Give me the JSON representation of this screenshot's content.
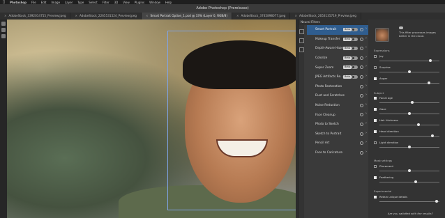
{
  "menubar": {
    "items": [
      "Photoshop",
      "File",
      "Edit",
      "Image",
      "Layer",
      "Type",
      "Select",
      "Filter",
      "3D",
      "View",
      "Plugins",
      "Window",
      "Help"
    ]
  },
  "window": {
    "title": "Adobe Photoshop (Prerelease)"
  },
  "tabs": [
    {
      "label": "AdobeStock_3392014755_Preview.jpeg",
      "active": false
    },
    {
      "label": "AdobeStock_2265531524_Preview.jpeg",
      "active": false
    },
    {
      "label": "Smart Portrait Option_1.psd @ 33% (Layer 0, RGB/8)",
      "active": true
    },
    {
      "label": "AdobeStock_3745898077.jpeg",
      "active": false
    },
    {
      "label": "AdobeStock_2653135719_Preview.jpeg",
      "active": false
    }
  ],
  "neural_filters": {
    "header": "Neural Filters",
    "badge_label": "Beta",
    "filters": [
      {
        "name": "Smart Portrait",
        "beta": true,
        "toggle": true,
        "active": true
      },
      {
        "name": "Makeup Transfer",
        "beta": true,
        "toggle": true,
        "active": false
      },
      {
        "name": "Depth-Aware Haze",
        "beta": true,
        "toggle": true,
        "active": false
      },
      {
        "name": "Colorize",
        "beta": true,
        "toggle": true,
        "active": false
      },
      {
        "name": "Super Zoom",
        "beta": true,
        "toggle": true,
        "active": false
      },
      {
        "name": "JPEG Artifacts Re...",
        "beta": true,
        "toggle": true,
        "active": false
      },
      {
        "name": "Photo Restoration",
        "beta": false,
        "toggle": false,
        "active": false
      },
      {
        "name": "Dust and Scratches",
        "beta": false,
        "toggle": false,
        "active": false
      },
      {
        "name": "Noise Reduction",
        "beta": false,
        "toggle": false,
        "active": false
      },
      {
        "name": "Face Cleanup",
        "beta": false,
        "toggle": false,
        "active": false
      },
      {
        "name": "Photo to Sketch",
        "beta": false,
        "toggle": false,
        "active": false
      },
      {
        "name": "Sketch to Portrait",
        "beta": false,
        "toggle": false,
        "active": false
      },
      {
        "name": "Pencil Art",
        "beta": false,
        "toggle": false,
        "active": false
      },
      {
        "name": "Face to Caricature",
        "beta": false,
        "toggle": false,
        "active": false
      }
    ]
  },
  "smart_portrait": {
    "description": "This filter processes images better in the cloud.",
    "sections": {
      "expressions": "Expressions",
      "subject": "Subject",
      "mask_settings": "Mask settings",
      "experimental": "Experimental"
    },
    "sliders": [
      {
        "label": "Joy",
        "value": "",
        "checked": false,
        "position": 0.85
      },
      {
        "label": "Surprise",
        "value": "",
        "checked": false,
        "position": 0.5
      },
      {
        "label": "Anger",
        "value": "",
        "checked": true,
        "position": 0.82
      },
      {
        "label": "Facial age",
        "value": "",
        "checked": true,
        "position": 0.55
      },
      {
        "label": "Gaze",
        "value": "",
        "checked": true,
        "position": 0.5
      },
      {
        "label": "Hair thickness",
        "value": "",
        "checked": true,
        "position": 0.65
      },
      {
        "label": "Head direction",
        "value": "",
        "checked": true,
        "position": 0.88
      },
      {
        "label": "Light direction",
        "value": "",
        "checked": false,
        "position": 0.5
      },
      {
        "label": "Placement",
        "value": "",
        "checked": false,
        "position": 0.5
      },
      {
        "label": "Feathering",
        "value": "",
        "checked": true,
        "position": 0.6
      },
      {
        "label": "Retain unique details",
        "value": "",
        "checked": true,
        "position": 0.95
      }
    ],
    "question": "Are you satisfied with the results?"
  }
}
